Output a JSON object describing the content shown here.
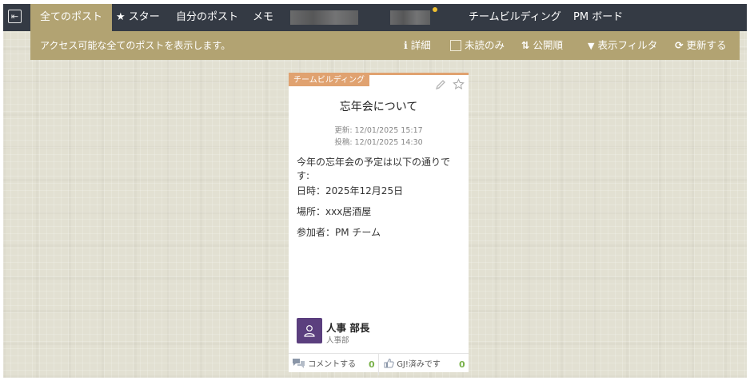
{
  "nav": {
    "tabs": [
      {
        "label": "全てのポスト",
        "active": true
      },
      {
        "label": "★ スター"
      },
      {
        "label": "自分のポスト"
      },
      {
        "label": "メモ"
      }
    ],
    "right_tabs": [
      {
        "label": "チームビルディング"
      },
      {
        "label": "PM ボード"
      }
    ]
  },
  "subbar": {
    "description": "アクセス可能な全てのポストを表示します。",
    "details": "詳細",
    "unread_only": "未読のみ",
    "sort": "公開順",
    "filter": "表示フィルタ",
    "refresh": "更新する"
  },
  "card": {
    "tag": "チームビルディング",
    "title": "忘年会について",
    "updated": "更新: 12/01/2025 15:17",
    "posted": "投稿: 12/01/2025 14:30",
    "body": [
      "今年の忘年会の予定は以下の通りです:",
      "日時：2025年12月25日",
      "場所：xxx居酒屋",
      "参加者：PM チーム"
    ],
    "author": {
      "name": "人事 部長",
      "department": "人事部"
    },
    "comment_label": "コメントする",
    "comment_count": "0",
    "gj_label": "GJ!済みです",
    "gj_count": "0"
  },
  "colors": {
    "nav_bg": "#343a44",
    "accent": "#b2a372",
    "tag": "#e0a270",
    "avatar": "#5b3f7e",
    "count": "#7ab24a"
  }
}
